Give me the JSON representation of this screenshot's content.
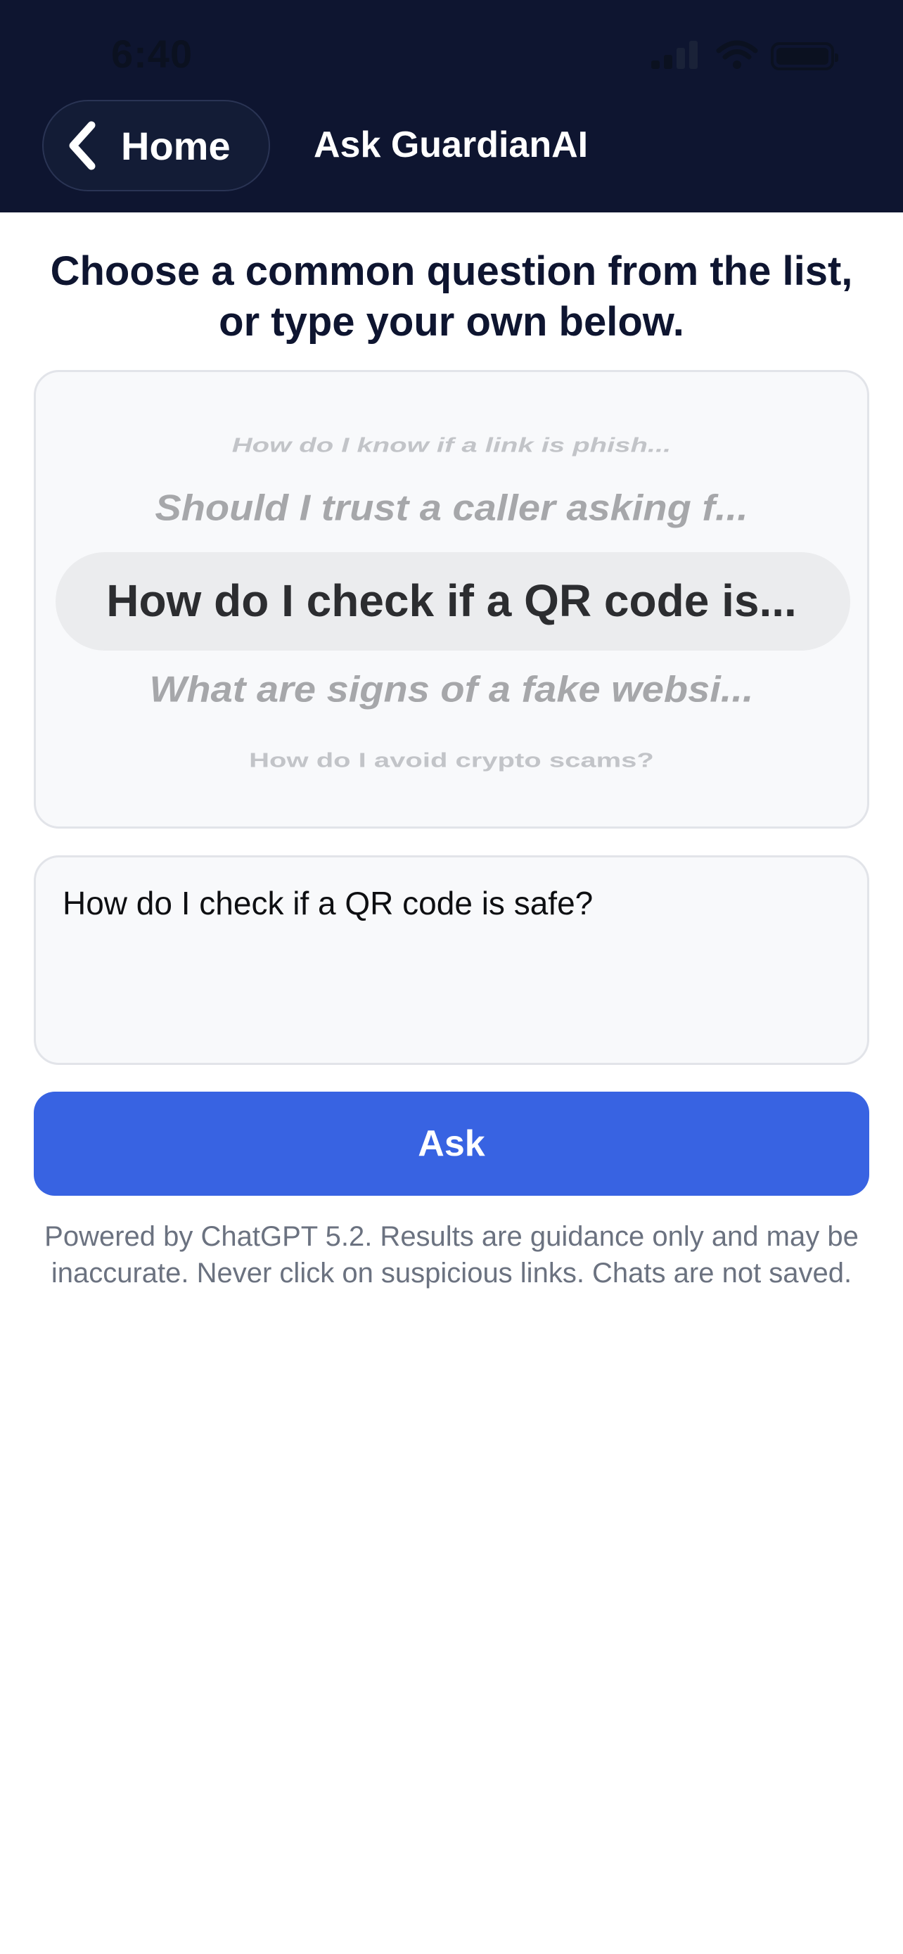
{
  "status_bar": {
    "time": "6:40"
  },
  "header": {
    "back_label": "Home",
    "title": "Ask GuardianAI"
  },
  "prompt": "Choose a common question from the list, or type your own below.",
  "picker": {
    "options": [
      "",
      "How do I know if a link is phish...",
      "Should I trust a caller asking f...",
      "How do I check if a QR code is...",
      "What are signs of a fake websi...",
      "How do I avoid crypto scams?",
      ""
    ],
    "selected_index": 3
  },
  "question_input": {
    "value": "How do I check if a QR code is safe?"
  },
  "ask_button": "Ask",
  "disclaimer": "Powered by ChatGPT 5.2. Results are guidance only and may be inaccurate. Never click on suspicious links. Chats are not saved."
}
